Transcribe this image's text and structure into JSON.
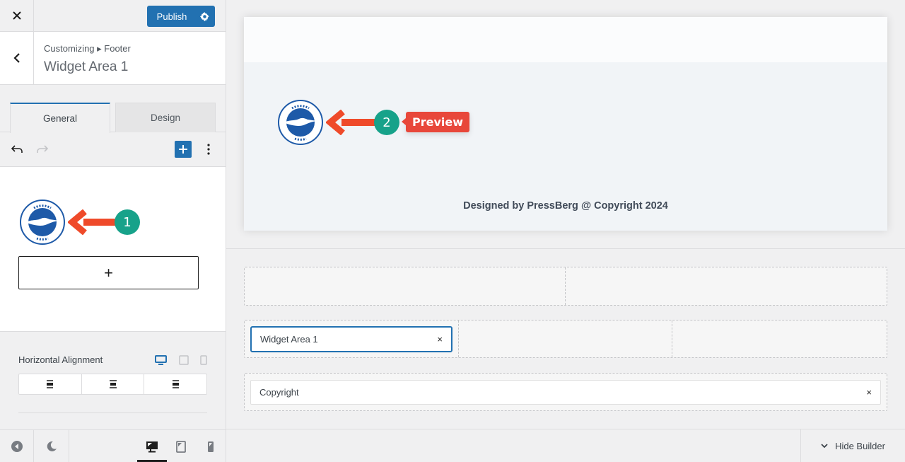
{
  "sidebar": {
    "close_label": "Close",
    "publish_label": "Publish",
    "breadcrumb": "Customizing ▸ Footer",
    "section_title": "Widget Area 1",
    "tabs": [
      {
        "label": "General",
        "active": true
      },
      {
        "label": "Design",
        "active": false
      }
    ],
    "editor": {
      "add_block_symbol": "+",
      "image_block_alt": "Brighton & Hove Albion logo",
      "annotation_number": "1"
    },
    "horizontal_alignment": {
      "label": "Horizontal Alignment",
      "devices": [
        "desktop",
        "tablet",
        "mobile"
      ],
      "active_device": "desktop",
      "options": [
        "left",
        "center",
        "right"
      ]
    },
    "footer_devices": [
      "desktop",
      "tablet",
      "mobile"
    ],
    "active_footer_device": "desktop"
  },
  "preview": {
    "annotation_number": "2",
    "annotation_label": "Preview",
    "copyright_text": "Designed by PressBerg @ Copyright 2024",
    "accent_annotation": "#e8473a",
    "badge_color": "#17a28a"
  },
  "builder": {
    "rows": [
      {
        "cells": [
          "",
          ""
        ]
      },
      {
        "cells": [
          "Widget Area 1",
          "",
          ""
        ]
      },
      {
        "cells": [
          "Copyright"
        ]
      }
    ],
    "widget_item": "Widget Area 1",
    "copyright_item": "Copyright",
    "remove_symbol": "×",
    "hide_builder_label": "Hide Builder"
  },
  "colors": {
    "primary": "#2271b1",
    "background": "#f0f0f1"
  }
}
